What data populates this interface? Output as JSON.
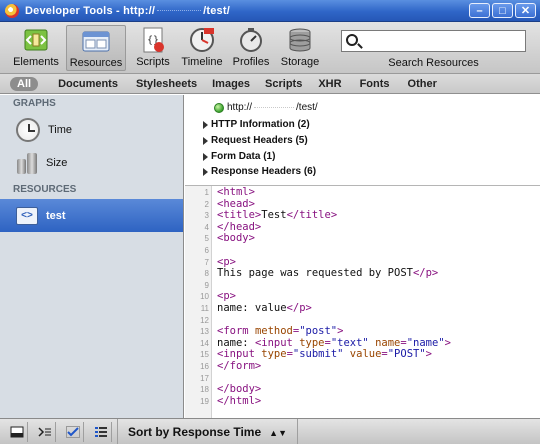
{
  "window": {
    "title": "Developer Tools - http://",
    "title_suffix": "/test/"
  },
  "toolbar": {
    "buttons": [
      {
        "label": "Elements",
        "icon": "elements-icon"
      },
      {
        "label": "Resources",
        "icon": "resources-icon",
        "active": true
      },
      {
        "label": "Scripts",
        "icon": "scripts-icon"
      },
      {
        "label": "Timeline",
        "icon": "timeline-icon"
      },
      {
        "label": "Profiles",
        "icon": "profiles-icon"
      },
      {
        "label": "Storage",
        "icon": "storage-icon"
      }
    ],
    "search_label": "Search Resources",
    "search_value": ""
  },
  "filters": [
    "All",
    "Documents",
    "Stylesheets",
    "Images",
    "Scripts",
    "XHR",
    "Fonts",
    "Other"
  ],
  "sidebar": {
    "graphs_heading": "GRAPHS",
    "graphs": [
      {
        "label": "Time",
        "icon": "clock-icon"
      },
      {
        "label": "Size",
        "icon": "weight-icon"
      }
    ],
    "resources_heading": "RESOURCES",
    "resources": [
      {
        "label": "test",
        "icon": "html-document-icon",
        "selected": true
      }
    ]
  },
  "headers": {
    "url_prefix": "http://",
    "url_suffix": "/test/",
    "sections": [
      "HTTP Information (2)",
      "Request Headers (5)",
      "Form Data (1)",
      "Response Headers (6)"
    ]
  },
  "code": {
    "lines": [
      [
        {
          "t": "tag",
          "s": "<html>"
        }
      ],
      [
        {
          "t": "tag",
          "s": "<head>"
        }
      ],
      [
        {
          "t": "tag",
          "s": "<title>"
        },
        {
          "t": "txt",
          "s": "Test"
        },
        {
          "t": "tag",
          "s": "</title>"
        }
      ],
      [
        {
          "t": "tag",
          "s": "</head>"
        }
      ],
      [
        {
          "t": "tag",
          "s": "<body>"
        }
      ],
      [],
      [
        {
          "t": "tag",
          "s": "<p>"
        }
      ],
      [
        {
          "t": "txt",
          "s": "This page was requested by POST"
        },
        {
          "t": "tag",
          "s": "</p>"
        }
      ],
      [],
      [
        {
          "t": "tag",
          "s": "<p>"
        }
      ],
      [
        {
          "t": "txt",
          "s": "name: value"
        },
        {
          "t": "tag",
          "s": "</p>"
        }
      ],
      [],
      [
        {
          "t": "tag",
          "s": "<form "
        },
        {
          "t": "attr",
          "s": "method"
        },
        {
          "t": "tag",
          "s": "="
        },
        {
          "t": "val",
          "s": "\"post\""
        },
        {
          "t": "tag",
          "s": ">"
        }
      ],
      [
        {
          "t": "txt",
          "s": "name: "
        },
        {
          "t": "tag",
          "s": "<input "
        },
        {
          "t": "attr",
          "s": "type"
        },
        {
          "t": "tag",
          "s": "="
        },
        {
          "t": "val",
          "s": "\"text\""
        },
        {
          "t": "tag",
          "s": " "
        },
        {
          "t": "attr",
          "s": "name"
        },
        {
          "t": "tag",
          "s": "="
        },
        {
          "t": "val",
          "s": "\"name\""
        },
        {
          "t": "tag",
          "s": ">"
        }
      ],
      [
        {
          "t": "tag",
          "s": "<input "
        },
        {
          "t": "attr",
          "s": "type"
        },
        {
          "t": "tag",
          "s": "="
        },
        {
          "t": "val",
          "s": "\"submit\""
        },
        {
          "t": "tag",
          "s": " "
        },
        {
          "t": "attr",
          "s": "value"
        },
        {
          "t": "tag",
          "s": "="
        },
        {
          "t": "val",
          "s": "\"POST\""
        },
        {
          "t": "tag",
          "s": ">"
        }
      ],
      [
        {
          "t": "tag",
          "s": "</form>"
        }
      ],
      [],
      [
        {
          "t": "tag",
          "s": "</body>"
        }
      ],
      [
        {
          "t": "tag",
          "s": "</html>"
        }
      ]
    ]
  },
  "statusbar": {
    "buttons": [
      "dock-icon",
      "console-icon",
      "checkmark-icon",
      "list-icon"
    ],
    "sort_label": "Sort by Response Time",
    "sort_arrows": "▲▼"
  },
  "colors": {
    "titlebar": "#2f66c8",
    "selection": "#2e63c2",
    "tag": "#881280",
    "attribute": "#994500",
    "value": "#1a1aa6"
  }
}
